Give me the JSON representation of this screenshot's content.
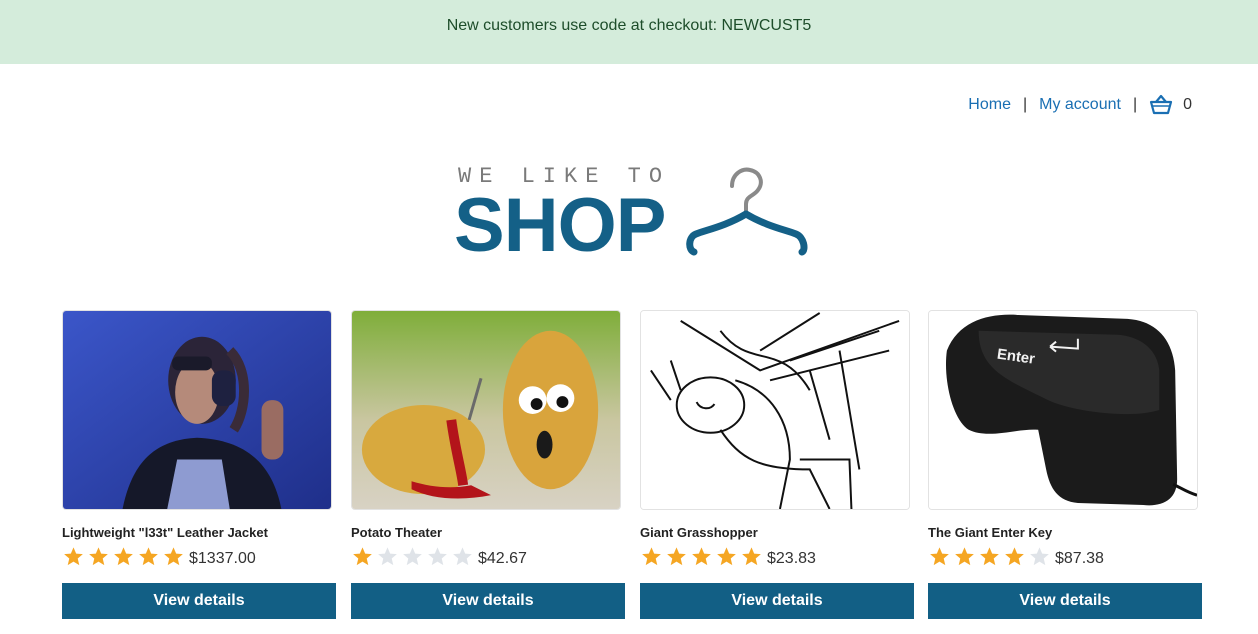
{
  "banner": {
    "text": "New customers use code at checkout: NEWCUST5"
  },
  "nav": {
    "home": "Home",
    "separator": "|",
    "account": "My account",
    "cart_count": "0",
    "cart_icon": "basket-icon"
  },
  "logo": {
    "tagline": "WE LIKE TO",
    "name": "SHOP",
    "icon": "hanger-icon",
    "brand_color": "#146087"
  },
  "products": [
    {
      "title": "Lightweight \"l33t\" Leather Jacket",
      "rating": 5,
      "price": "$1337.00",
      "button": "View details"
    },
    {
      "title": "Potato Theater",
      "rating": 1,
      "price": "$42.67",
      "button": "View details"
    },
    {
      "title": "Giant Grasshopper",
      "rating": 5,
      "price": "$23.83",
      "button": "View details"
    },
    {
      "title": "The Giant Enter Key",
      "rating": 4,
      "price": "$87.38",
      "button": "View details",
      "image_text": "Enter"
    }
  ],
  "colors": {
    "banner_bg": "#d4ecdb",
    "link": "#1a6fb3",
    "button": "#125f85",
    "star_filled": "#f5a623",
    "star_empty": "#dfe3e8"
  }
}
